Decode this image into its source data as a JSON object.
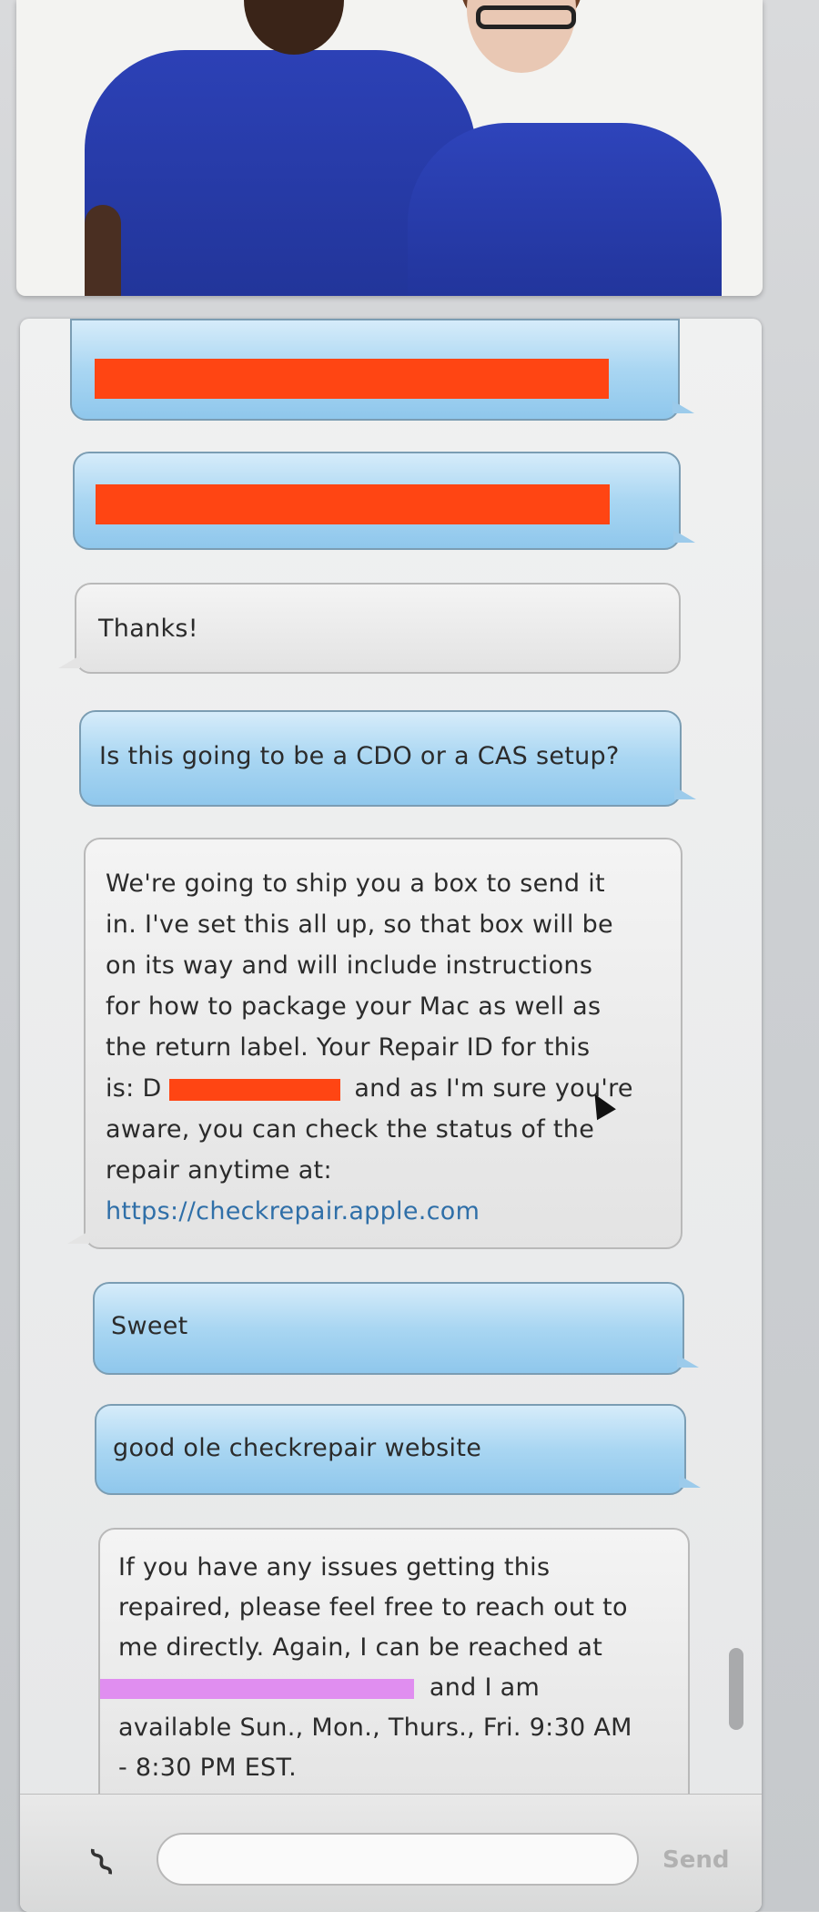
{
  "header": {
    "image_alt": "Apple support advisors"
  },
  "messages": [
    {
      "side": "out",
      "redacted": true
    },
    {
      "side": "out",
      "redacted": true
    },
    {
      "side": "in",
      "text": "Thanks!"
    },
    {
      "side": "out",
      "text": "Is this going to be a CDO or a CAS setup?"
    },
    {
      "side": "in",
      "lines": [
        "We're going to ship you a box to send it",
        "in. I've set this all up, so that box will be",
        "on its way and will include instructions",
        "for how to package your Mac as well as",
        "the return label. Your Repair ID for this",
        "and as I'm sure you're",
        "aware, you can check the status of the",
        "repair anytime at:"
      ],
      "line6_prefix": "is: D",
      "link": "https://checkrepair.apple.com"
    },
    {
      "side": "out",
      "text": "Sweet"
    },
    {
      "side": "out",
      "text": "good ole checkrepair website"
    },
    {
      "side": "in",
      "lines": [
        "If you have any issues getting this",
        "repaired, please feel free to reach out to",
        "me directly. Again, I can be reached at",
        "and I am",
        "available Sun., Mon., Thurs., Fri. 9:30 AM",
        "- 8:30 PM EST."
      ]
    }
  ],
  "composer": {
    "placeholder": "",
    "send_label": "Send"
  },
  "colors": {
    "redaction": "#ff4513",
    "highlight": "#e08ef0",
    "link": "#2f6fa8"
  }
}
